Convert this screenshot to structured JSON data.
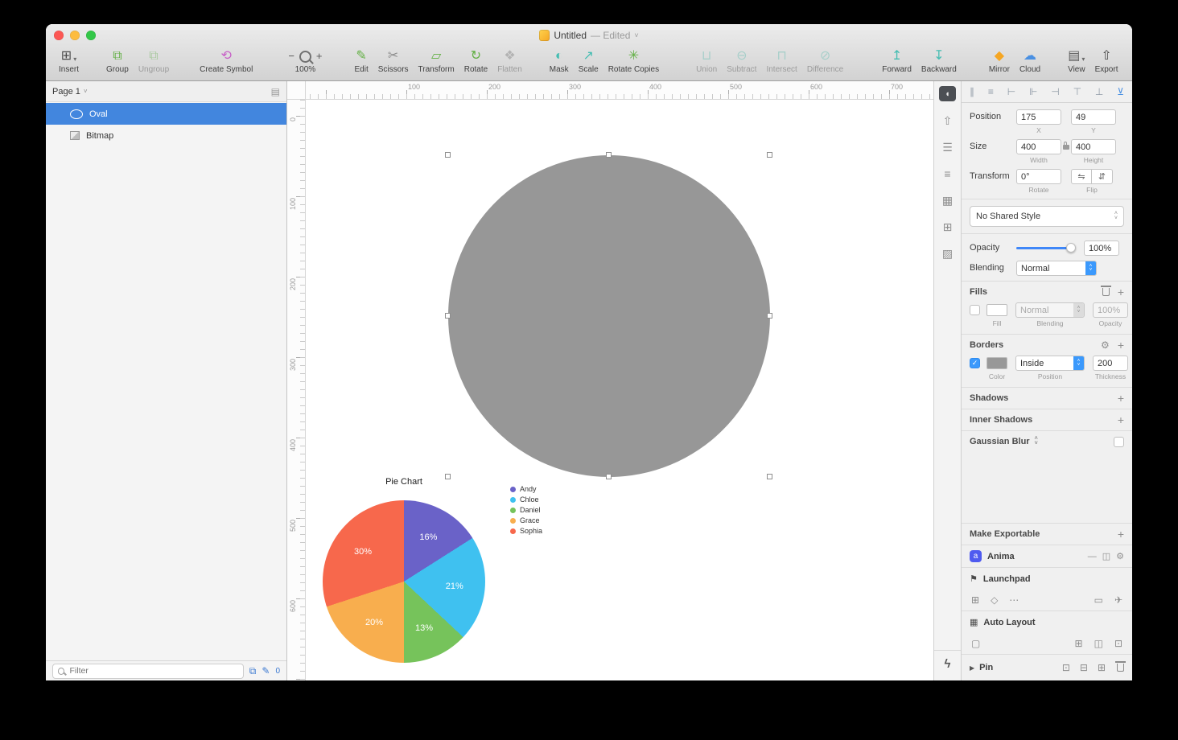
{
  "titlebar": {
    "title": "Untitled",
    "status": "— Edited"
  },
  "icons": {
    "chevron_down": "˅",
    "caret_down": "▾",
    "caret_right": "▶",
    "plus": "+",
    "gear": "⚙",
    "minimize": "—",
    "panel": "◫",
    "stepper_up": "˄",
    "stepper_down": "˅",
    "check": "✓",
    "dots": "⋯",
    "monitor": "▭",
    "rocket": "✈",
    "flag": "⚑",
    "grid": "⊞",
    "diamond": "◇",
    "square": "▢",
    "auto_layout": "▦",
    "pin_a": "⊡",
    "pin_b": "⊟",
    "pin_c": "⊞",
    "page_list": "▤",
    "overlap": "⧉",
    "pencil": "✎",
    "anima_letter": "a"
  },
  "toolbar": {
    "zoom": {
      "minus": "−",
      "plus": "+",
      "level": "100%"
    },
    "groups": [
      [
        {
          "name": "insert",
          "label": "Insert",
          "glyph": "⊞",
          "color": "#4a4a4a",
          "caret": true
        }
      ],
      [
        {
          "name": "group",
          "label": "Group",
          "glyph": "⧉",
          "color": "#63b045"
        },
        {
          "name": "ungroup",
          "label": "Ungroup",
          "glyph": "⧉",
          "color": "#aac9a0",
          "disabled": true
        }
      ],
      [
        {
          "name": "create-symbol",
          "label": "Create Symbol",
          "glyph": "⟲",
          "color": "#c75fc7"
        }
      ],
      [
        {
          "name": "edit",
          "label": "Edit",
          "glyph": "✎",
          "color": "#63b045"
        },
        {
          "name": "scissors",
          "label": "Scissors",
          "glyph": "✂",
          "color": "#8a8a8a"
        },
        {
          "name": "transform",
          "label": "Transform",
          "glyph": "▱",
          "color": "#63b045"
        },
        {
          "name": "rotate",
          "label": "Rotate",
          "glyph": "↻",
          "color": "#63b045"
        },
        {
          "name": "flatten",
          "label": "Flatten",
          "glyph": "❖",
          "color": "#b3b3b3",
          "disabled": true
        }
      ],
      [
        {
          "name": "mask",
          "label": "Mask",
          "glyph": "◐",
          "color": "#45bdb2"
        },
        {
          "name": "scale",
          "label": "Scale",
          "glyph": "↗",
          "color": "#45bdb2"
        },
        {
          "name": "rotate-copies",
          "label": "Rotate Copies",
          "glyph": "✳",
          "color": "#63b045"
        }
      ],
      [
        {
          "name": "union",
          "label": "Union",
          "glyph": "⊔",
          "color": "#a8cfca",
          "disabled": true
        },
        {
          "name": "subtract",
          "label": "Subtract",
          "glyph": "⊖",
          "color": "#a8cfca",
          "disabled": true
        },
        {
          "name": "intersect",
          "label": "Intersect",
          "glyph": "⊓",
          "color": "#a8cfca",
          "disabled": true
        },
        {
          "name": "difference",
          "label": "Difference",
          "glyph": "⊘",
          "color": "#a8cfca",
          "disabled": true
        }
      ],
      [
        {
          "name": "forward",
          "label": "Forward",
          "glyph": "↥",
          "color": "#45bdb2"
        },
        {
          "name": "backward",
          "label": "Backward",
          "glyph": "↧",
          "color": "#45bdb2"
        }
      ],
      [
        {
          "name": "mirror",
          "label": "Mirror",
          "glyph": "◆",
          "color": "#f5a623"
        },
        {
          "name": "cloud",
          "label": "Cloud",
          "glyph": "☁",
          "color": "#4a90e2"
        }
      ],
      [
        {
          "name": "view",
          "label": "View",
          "glyph": "▤",
          "color": "#5a5a5a",
          "caret": true
        }
      ],
      [
        {
          "name": "export",
          "label": "Export",
          "glyph": "⇧",
          "color": "#4a4a4a"
        }
      ]
    ]
  },
  "sidebar": {
    "page_header": {
      "label": "Page 1"
    },
    "layers": [
      {
        "label": "Oval",
        "selected": true
      },
      {
        "label": "Bitmap",
        "selected": false
      }
    ],
    "filter_placeholder": "Filter",
    "badge_count": "0"
  },
  "canvas": {
    "h_ruler": [
      "100",
      "200",
      "300",
      "400",
      "500",
      "600",
      "700"
    ],
    "v_ruler": [
      "0",
      "100",
      "200",
      "300",
      "400",
      "500",
      "600"
    ],
    "shape_fill": "#979797"
  },
  "chart_data": {
    "type": "pie",
    "title": "Pie Chart",
    "labels": [
      "Andy",
      "Chloe",
      "Daniel",
      "Grace",
      "Sophia"
    ],
    "values": [
      16,
      21,
      13,
      20,
      30
    ],
    "value_labels": [
      "16%",
      "21%",
      "13%",
      "20%",
      "30%"
    ],
    "colors": [
      "#6a62c8",
      "#3fc1f0",
      "#76c35b",
      "#f8ae4e",
      "#f7684c"
    ],
    "legend_position": "right"
  },
  "strip": {
    "toggle_glyph": "◖",
    "icons": [
      {
        "name": "share-icon",
        "glyph": "⇧"
      },
      {
        "name": "sliders-icon",
        "glyph": "☰"
      },
      {
        "name": "list-icon",
        "glyph": "≡"
      },
      {
        "name": "mask-checker-icon",
        "glyph": "▦"
      },
      {
        "name": "crop-icon",
        "glyph": "⊞"
      },
      {
        "name": "image-icon",
        "glyph": "▨"
      }
    ],
    "lightning_glyph": "ϟ"
  },
  "inspector": {
    "align_icons": [
      {
        "name": "distribute-horizontally-icon",
        "glyph": "∥",
        "color": "#8f9aa6"
      },
      {
        "name": "distribute-vertically-icon",
        "glyph": "≡",
        "color": "#8f9aa6"
      },
      {
        "name": "align-left-icon",
        "glyph": "⊢",
        "color": "#8f9aa6"
      },
      {
        "name": "align-center-horizontal-icon",
        "glyph": "⊩",
        "color": "#8f9aa6"
      },
      {
        "name": "align-right-icon",
        "glyph": "⊣",
        "color": "#8f9aa6"
      },
      {
        "name": "align-top-icon",
        "glyph": "⊤",
        "color": "#8f9aa6"
      },
      {
        "name": "align-middle-icon",
        "glyph": "⊥",
        "color": "#8f9aa6"
      },
      {
        "name": "align-bottom-icon",
        "glyph": "⊻",
        "color": "#4a90e2"
      }
    ],
    "position": {
      "label": "Position",
      "x": "175",
      "y": "49",
      "x_label": "X",
      "y_label": "Y"
    },
    "size": {
      "label": "Size",
      "width": "400",
      "height": "400",
      "width_label": "Width",
      "height_label": "Height"
    },
    "transform": {
      "label": "Transform",
      "rotate": "0°",
      "rotate_label": "Rotate",
      "flip_label": "Flip",
      "flip_h": "⇋",
      "flip_v": "⇵"
    },
    "shared_style": "No Shared Style",
    "opacity": {
      "label": "Opacity",
      "value": "100%"
    },
    "blending": {
      "label": "Blending",
      "value": "Normal"
    },
    "fills": {
      "header": "Fills",
      "blending": "Normal",
      "opacity": "100%",
      "col1": "Fill",
      "col2": "Blending",
      "col3": "Opacity"
    },
    "borders": {
      "header": "Borders",
      "position": "Inside",
      "thickness": "200",
      "col1": "Color",
      "col2": "Position",
      "col3": "Thickness"
    },
    "shadows": "Shadows",
    "inner_shadows": "Inner Shadows",
    "gaussian_blur": "Gaussian Blur",
    "make_exportable": "Make Exportable",
    "anima": {
      "title": "Anima",
      "launchpad": "Launchpad",
      "auto_layout": "Auto Layout",
      "pin": "Pin"
    }
  }
}
